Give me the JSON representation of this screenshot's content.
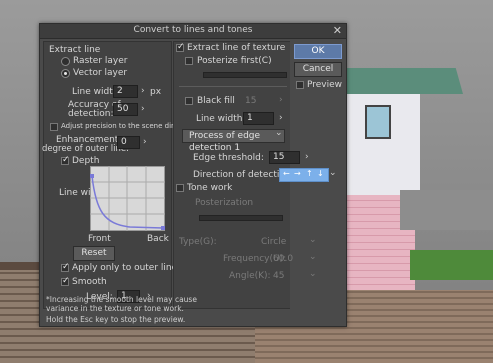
{
  "dialog": {
    "title": "Convert to lines and tones",
    "close_glyph": "✕"
  },
  "left": {
    "section_title": "Extract line",
    "raster_label": "Raster layer",
    "vector_label": "Vector layer",
    "selected_layer": "Vector layer",
    "line_width_label": "Line width:",
    "line_width_value": "2",
    "line_width_unit": "px",
    "accuracy_label_1": "Accuracy of",
    "accuracy_label_2": "detection:",
    "accuracy_value": "50",
    "adjust_precision_label": "Adjust precision to the scene dimension",
    "adjust_precision_checked": false,
    "enhancement_label_1": "Enhancement",
    "enhancement_label_2": "degree of outer line:",
    "enhancement_value": "0",
    "depth_label": "Depth",
    "depth_checked": true,
    "graph_y_label": "Line width",
    "graph_front_label": "Front",
    "graph_back_label": "Back",
    "reset_label": "Reset",
    "apply_outer_label": "Apply only to outer line",
    "apply_outer_checked": true,
    "smooth_label": "Smooth",
    "smooth_checked": true,
    "level_label": "Level:",
    "level_value": "1"
  },
  "right": {
    "extract_texture_label": "Extract line of texture",
    "extract_texture_checked": true,
    "posterize_label": "Posterize first(C)",
    "posterize_checked": false,
    "black_fill_label": "Black fill",
    "black_fill_checked": false,
    "black_fill_value": "15",
    "texture_line_width_label": "Line width(L):",
    "texture_line_width_value": "1",
    "process_dropdown": "Process of edge detection 1",
    "edge_threshold_label": "Edge threshold:",
    "edge_threshold_value": "15",
    "direction_label": "Direction of detection:",
    "tone_work_label": "Tone work",
    "tone_work_checked": false,
    "posterization_label": "Posterization",
    "type_label": "Type(G):",
    "type_value": "Circle",
    "frequency_label": "Frequency(U):",
    "frequency_value": "60.0",
    "angle_label": "Angle(K):",
    "angle_value": "45"
  },
  "buttons": {
    "ok": "OK",
    "cancel": "Cancel",
    "preview_label": "Preview",
    "preview_checked": false
  },
  "footer": {
    "note": "*Increasing the smooth level may cause variance in the texture or tone work.",
    "hint": "Hold the Esc key to stop the preview."
  },
  "icons": {
    "arrow_right": "›",
    "chevron_down": "⌄",
    "direction_arrows": [
      "←",
      "→",
      "↑",
      "↓"
    ]
  },
  "colors": {
    "dialog_bg": "#4a4a4a",
    "ok_button": "#5d7aa8",
    "direction_box": "#7cb0ea",
    "graph_curve": "#7a7ad8"
  }
}
